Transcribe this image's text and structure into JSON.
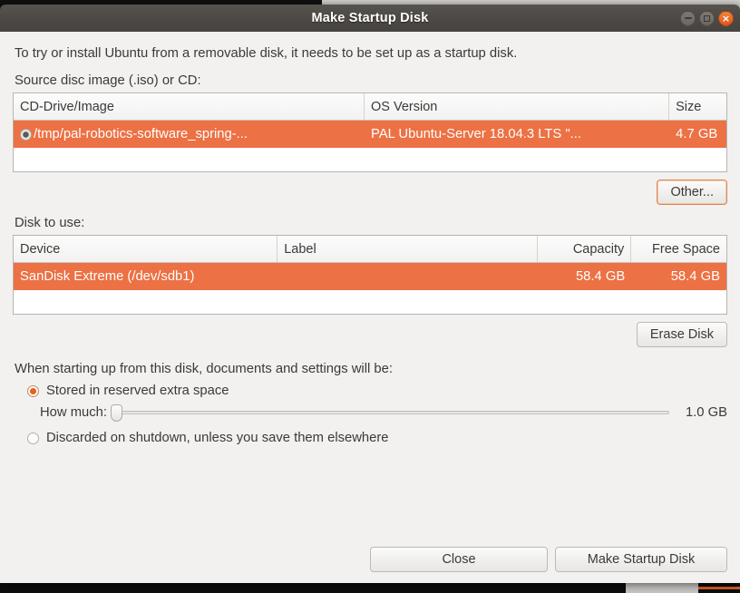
{
  "window": {
    "title": "Make Startup Disk",
    "controls": {
      "minimize": "minimize-button",
      "maximize": "maximize-button",
      "close": "×"
    }
  },
  "intro": {
    "text": "To try or install Ubuntu from a removable disk, it needs to be set up as a startup disk."
  },
  "source_section": {
    "label": "Source disc image (.iso) or CD:",
    "columns": [
      "CD-Drive/Image",
      "OS Version",
      "Size"
    ],
    "rows": [
      {
        "selected": true,
        "drive": "/tmp/pal-robotics-software_spring-...",
        "os_version": "PAL Ubuntu-Server 18.04.3 LTS \"...",
        "size": "4.7 GB"
      }
    ],
    "other_button": "Other..."
  },
  "disk_section": {
    "label": "Disk to use:",
    "columns": [
      "Device",
      "Label",
      "Capacity",
      "Free Space"
    ],
    "rows": [
      {
        "selected": true,
        "device": "SanDisk Extreme (/dev/sdb1)",
        "label": "",
        "capacity": "58.4 GB",
        "free_space": "58.4 GB"
      }
    ],
    "erase_button": "Erase Disk"
  },
  "options_section": {
    "prompt": "When starting up from this disk, documents and settings will be:",
    "stored_option": "Stored in reserved extra space",
    "stored_selected": true,
    "slider_label": "How much:",
    "slider_value": "1.0 GB",
    "slider_position_percent": 0,
    "discarded_option": "Discarded on shutdown, unless you save them elsewhere",
    "discarded_selected": false
  },
  "footer": {
    "close_label": "Close",
    "make_disk_label": "Make Startup Disk"
  },
  "colors": {
    "selection_orange": "#ec7144",
    "accent_orange": "#e8601c",
    "titlebar": "#4c4844",
    "dialog_bg": "#f2f1f0"
  }
}
